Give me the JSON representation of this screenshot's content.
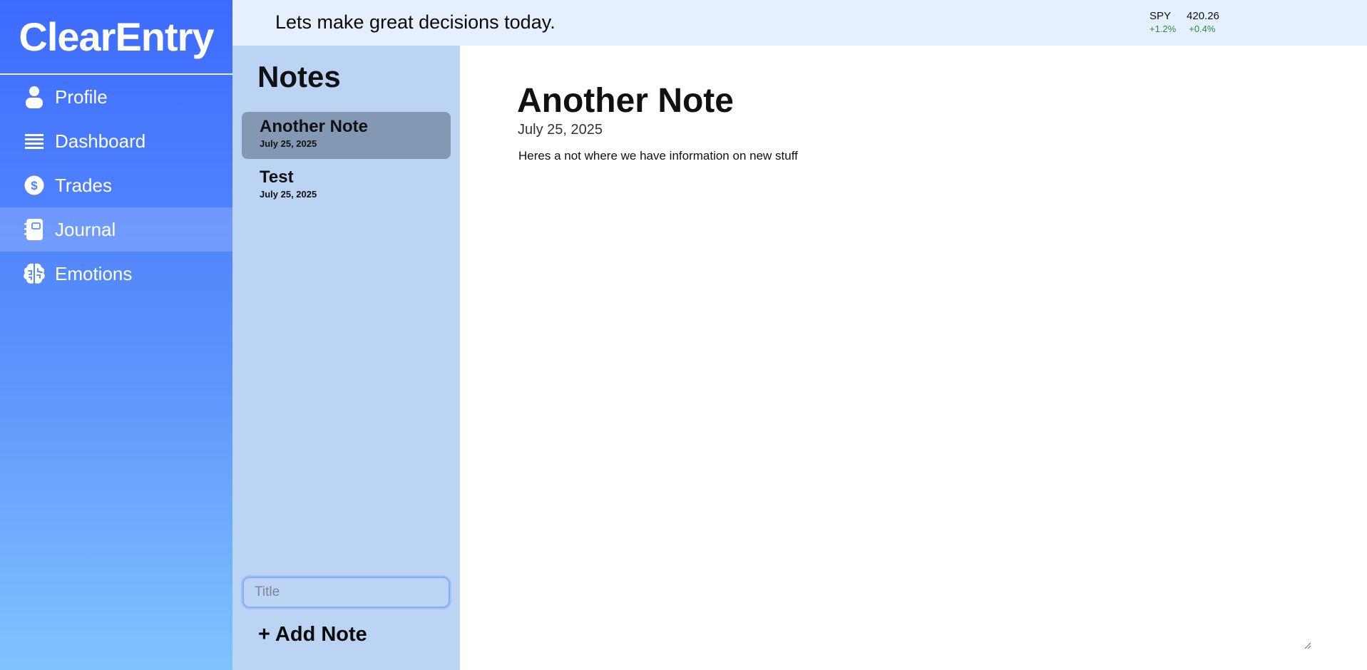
{
  "app": {
    "brand": "ClearEntry"
  },
  "sidebar": {
    "items": [
      {
        "label": "Profile",
        "icon": "user-icon"
      },
      {
        "label": "Dashboard",
        "icon": "list-icon"
      },
      {
        "label": "Trades",
        "icon": "dollar-icon"
      },
      {
        "label": "Journal",
        "icon": "notebook-icon",
        "active": true
      },
      {
        "label": "Emotions",
        "icon": "brain-icon"
      }
    ]
  },
  "topbar": {
    "tagline": "Lets make great decisions today.",
    "ticker": {
      "symbol": "SPY",
      "price": "420.26",
      "change_pct": "+1.2%",
      "change_alt": "+0.4%"
    }
  },
  "notes_panel": {
    "title": "Notes",
    "notes": [
      {
        "title": "Another Note",
        "date": "July 25, 2025",
        "selected": true
      },
      {
        "title": "Test",
        "date": "July 25, 2025"
      }
    ],
    "title_placeholder": "Title",
    "add_label": "+ Add Note"
  },
  "editor": {
    "title": "Another Note",
    "date": "July 25, 2025",
    "body": "Heres a not where we have information on new stuff"
  },
  "colors": {
    "sidebar_top": "#3d6bff",
    "sidebar_bottom": "#80c3ff",
    "notes_bg": "#bbd4f4",
    "selected_note": "#8399b3",
    "topbar_bg": "#e4f0fe",
    "positive": "#2a8a3a"
  }
}
